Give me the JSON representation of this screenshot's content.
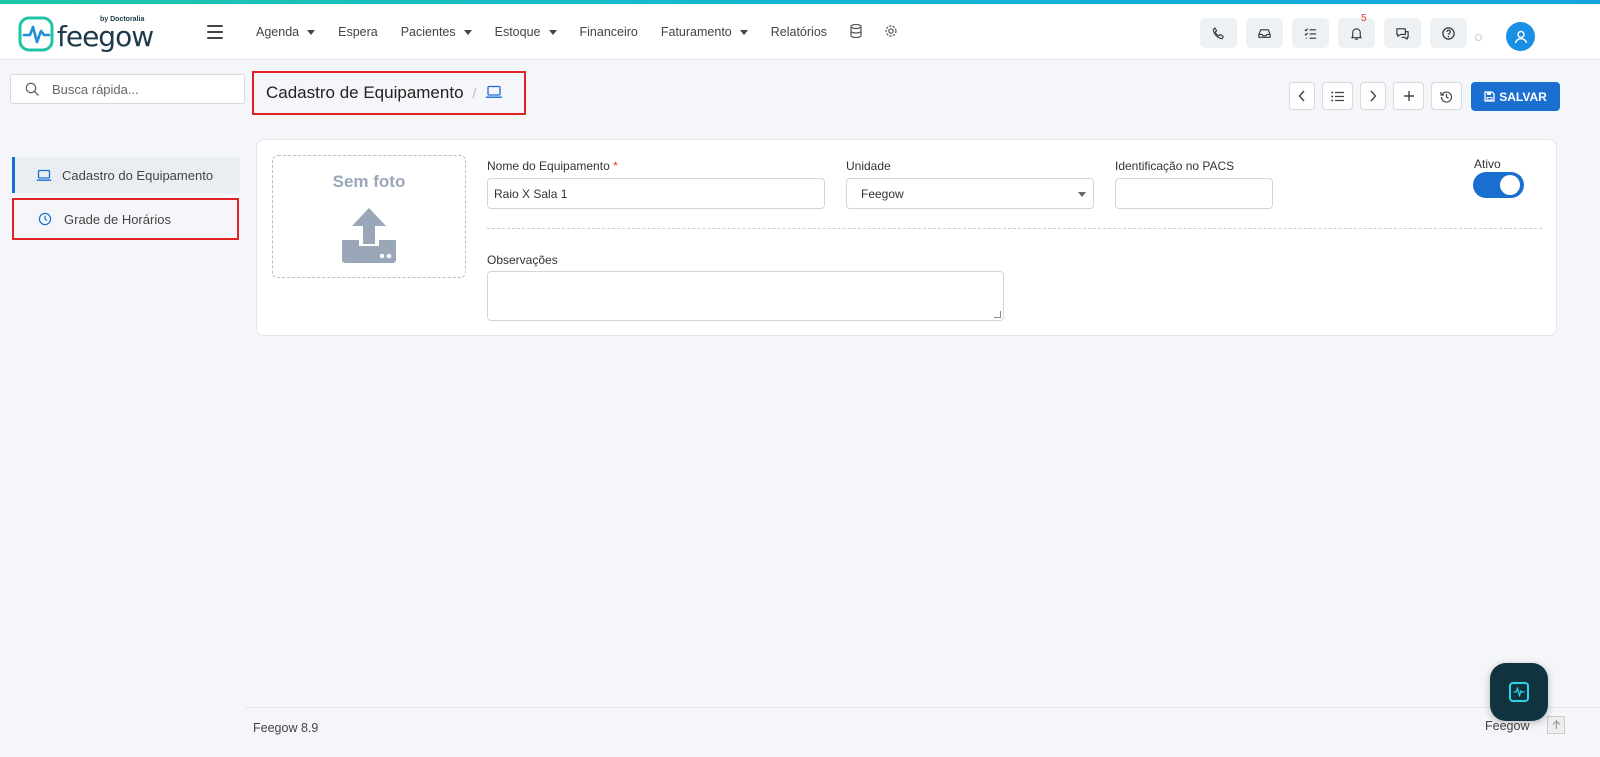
{
  "brand": {
    "name": "feegow",
    "by": "by Doctoralia",
    "accent": "#1a6fd1"
  },
  "nav": {
    "items": [
      {
        "label": "Agenda",
        "dropdown": true
      },
      {
        "label": "Espera",
        "dropdown": false
      },
      {
        "label": "Pacientes",
        "dropdown": true
      },
      {
        "label": "Estoque",
        "dropdown": true
      },
      {
        "label": "Financeiro",
        "dropdown": false
      },
      {
        "label": "Faturamento",
        "dropdown": true
      },
      {
        "label": "Relatórios",
        "dropdown": false
      }
    ],
    "notifications_count": "5",
    "icons": [
      "database-icon",
      "gear-icon",
      "phone-icon",
      "inbox-icon",
      "tasks-icon",
      "bell-icon",
      "chat-icon",
      "help-icon",
      "user-icon"
    ]
  },
  "search": {
    "placeholder": "Busca rápida..."
  },
  "sidebar": {
    "items": [
      {
        "label": "Cadastro do Equipamento",
        "icon": "laptop-icon",
        "active": true
      },
      {
        "label": "Grade de Horários",
        "icon": "clock-icon",
        "active": false
      }
    ]
  },
  "header": {
    "title": "Cadastro de Equipamento",
    "icon": "laptop-icon"
  },
  "toolbar": {
    "save_label": "SALVAR"
  },
  "form": {
    "photo_label": "Sem foto",
    "name_label": "Nome do Equipamento",
    "required_mark": "*",
    "name_value": "Raio X Sala 1",
    "unit_label": "Unidade",
    "unit_value": "Feegow",
    "pacs_label": "Identificação no PACS",
    "pacs_value": "",
    "active_label": "Ativo",
    "active": true,
    "notes_label": "Observações",
    "notes_value": ""
  },
  "footer": {
    "version": "Feegow 8.9",
    "brand": "Feegow"
  }
}
